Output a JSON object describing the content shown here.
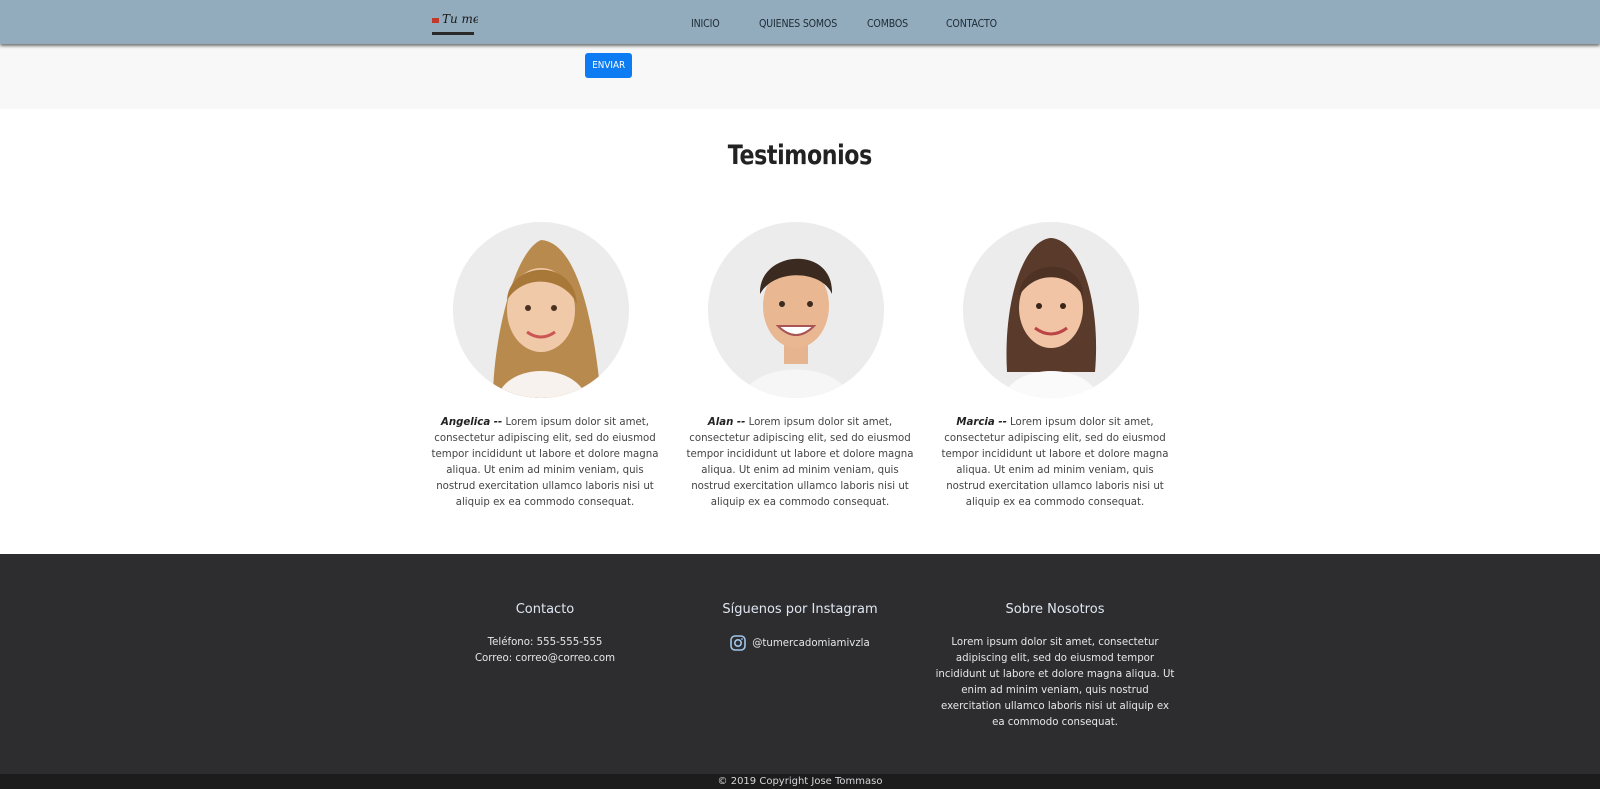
{
  "nav": {
    "logo_text": "Tu mercado",
    "items": [
      {
        "label": "INICIO"
      },
      {
        "label": "QUIENES SOMOS"
      },
      {
        "label": "COMBOS"
      },
      {
        "label": "CONTACTO"
      }
    ]
  },
  "form": {
    "submit_label": "ENVIAR"
  },
  "testimonials": {
    "title": "Testimonios",
    "items": [
      {
        "name": "Angelica --",
        "text": " Lorem ipsum dolor sit amet, consectetur adipiscing elit, sed do eiusmod tempor incididunt ut labore et dolore magna aliqua. Ut enim ad minim veniam, quis nostrud exercitation ullamco laboris nisi ut aliquip ex ea commodo consequat."
      },
      {
        "name": "Alan --",
        "text": " Lorem ipsum dolor sit amet, consectetur adipiscing elit, sed do eiusmod tempor incididunt ut labore et dolore magna aliqua. Ut enim ad minim veniam, quis nostrud exercitation ullamco laboris nisi ut aliquip ex ea commodo consequat."
      },
      {
        "name": "Marcia --",
        "text": " Lorem ipsum dolor sit amet, consectetur adipiscing elit, sed do eiusmod tempor incididunt ut labore et dolore magna aliqua. Ut enim ad minim veniam, quis nostrud exercitation ullamco laboris nisi ut aliquip ex ea commodo consequat."
      }
    ]
  },
  "footer": {
    "contact": {
      "title": "Contacto",
      "phone": "Teléfono: 555-555-555",
      "email": "Correo: correo@correo.com"
    },
    "instagram": {
      "title": "Síguenos por Instagram",
      "handle": "@tumercadomiamivzla",
      "icon": "instagram-icon"
    },
    "about": {
      "title": "Sobre Nosotros",
      "text": "Lorem ipsum dolor sit amet, consectetur adipiscing elit, sed do eiusmod tempor incididunt ut labore et dolore magna aliqua. Ut enim ad minim veniam, quis nostrud exercitation ullamco laboris nisi ut aliquip ex ea commodo consequat."
    },
    "copyright": "© 2019 Copyright Jose Tommaso"
  },
  "colors": {
    "navbar": "#92acbe",
    "button": "#0d7cf2",
    "footer": "#2d2c2e"
  }
}
